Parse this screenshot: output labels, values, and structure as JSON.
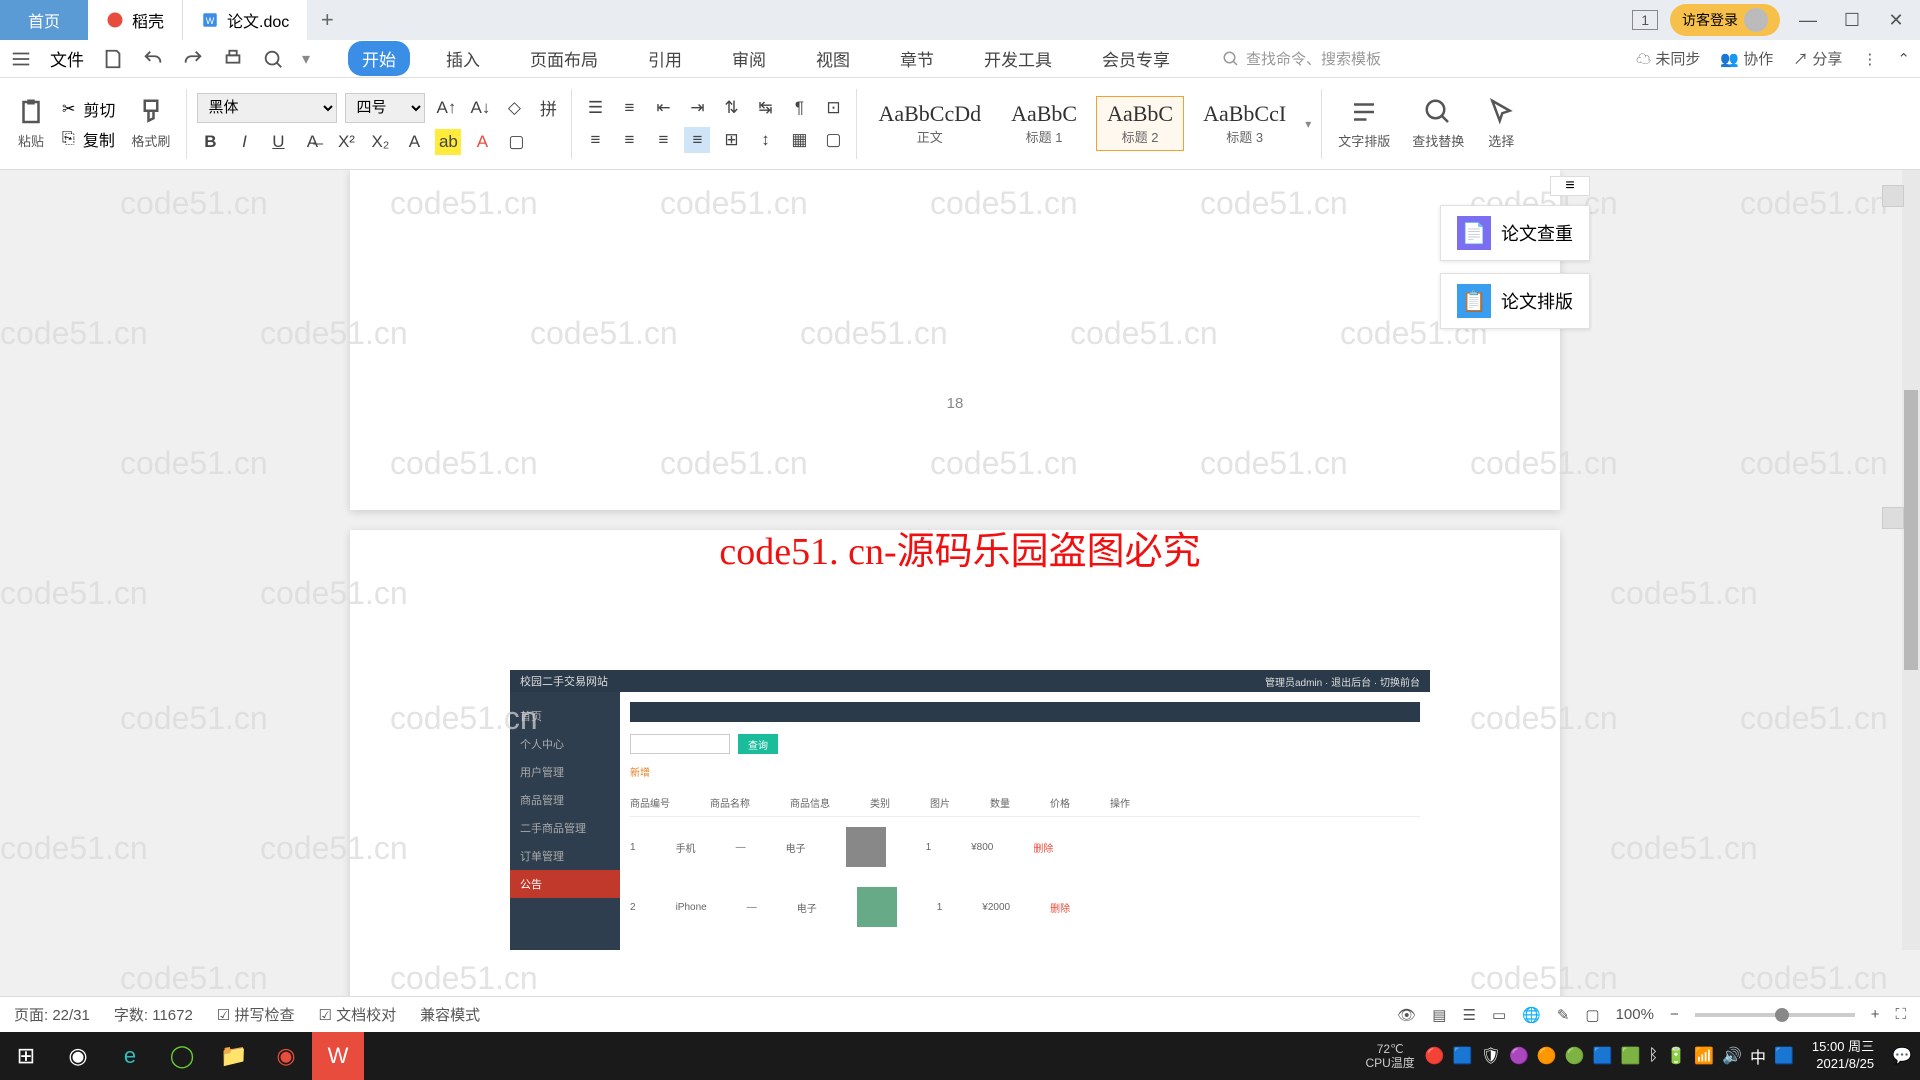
{
  "titlebar": {
    "home_tab": "首页",
    "doc_tab1": "稻壳",
    "doc_tab2": "论文.doc",
    "badge": "1",
    "login": "访客登录"
  },
  "quickbar": {
    "file": "文件",
    "search_placeholder": "查找命令、搜索模板"
  },
  "menu": {
    "start": "开始",
    "insert": "插入",
    "layout": "页面布局",
    "reference": "引用",
    "review": "审阅",
    "view": "视图",
    "chapter": "章节",
    "devtools": "开发工具",
    "member": "会员专享"
  },
  "right_tools": {
    "unsync": "未同步",
    "collab": "协作",
    "share": "分享"
  },
  "ribbon": {
    "paste": "粘贴",
    "cut": "剪切",
    "copy": "复制",
    "format_painter": "格式刷",
    "font": "黑体",
    "size": "四号",
    "styles": {
      "s1_prev": "AaBbCcDd",
      "s1_name": "正文",
      "s2_prev": "AaBbC",
      "s2_name": "标题 1",
      "s3_prev": "AaBbC",
      "s3_name": "标题 2",
      "s4_prev": "AaBbCcI",
      "s4_name": "标题 3"
    },
    "text_layout": "文字排版",
    "find_replace": "查找替换",
    "select": "选择"
  },
  "doc": {
    "page_num": "18",
    "banner": "code51. cn-源码乐园盗图必究"
  },
  "side": {
    "check": "论文查重",
    "format": "论文排版"
  },
  "embed": {
    "title": "校园二手交易网站",
    "search_btn": "查询",
    "tag": "新增",
    "menu1": "首页",
    "menu2": "个人中心",
    "menu3": "用户管理",
    "menu4": "商品管理",
    "menu5": "二手商品管理",
    "menu6": "订单管理",
    "menu7": "公告"
  },
  "status": {
    "page": "页面: 22/31",
    "words": "字数: 11672",
    "spell": "拼写检查",
    "proof": "文档校对",
    "compat": "兼容模式",
    "zoom": "100%"
  },
  "taskbar": {
    "cpu_temp": "72℃",
    "cpu_label": "CPU温度",
    "time": "15:00",
    "day": "周三",
    "date": "2021/8/25",
    "ime": "中"
  },
  "watermark": "code51.cn"
}
